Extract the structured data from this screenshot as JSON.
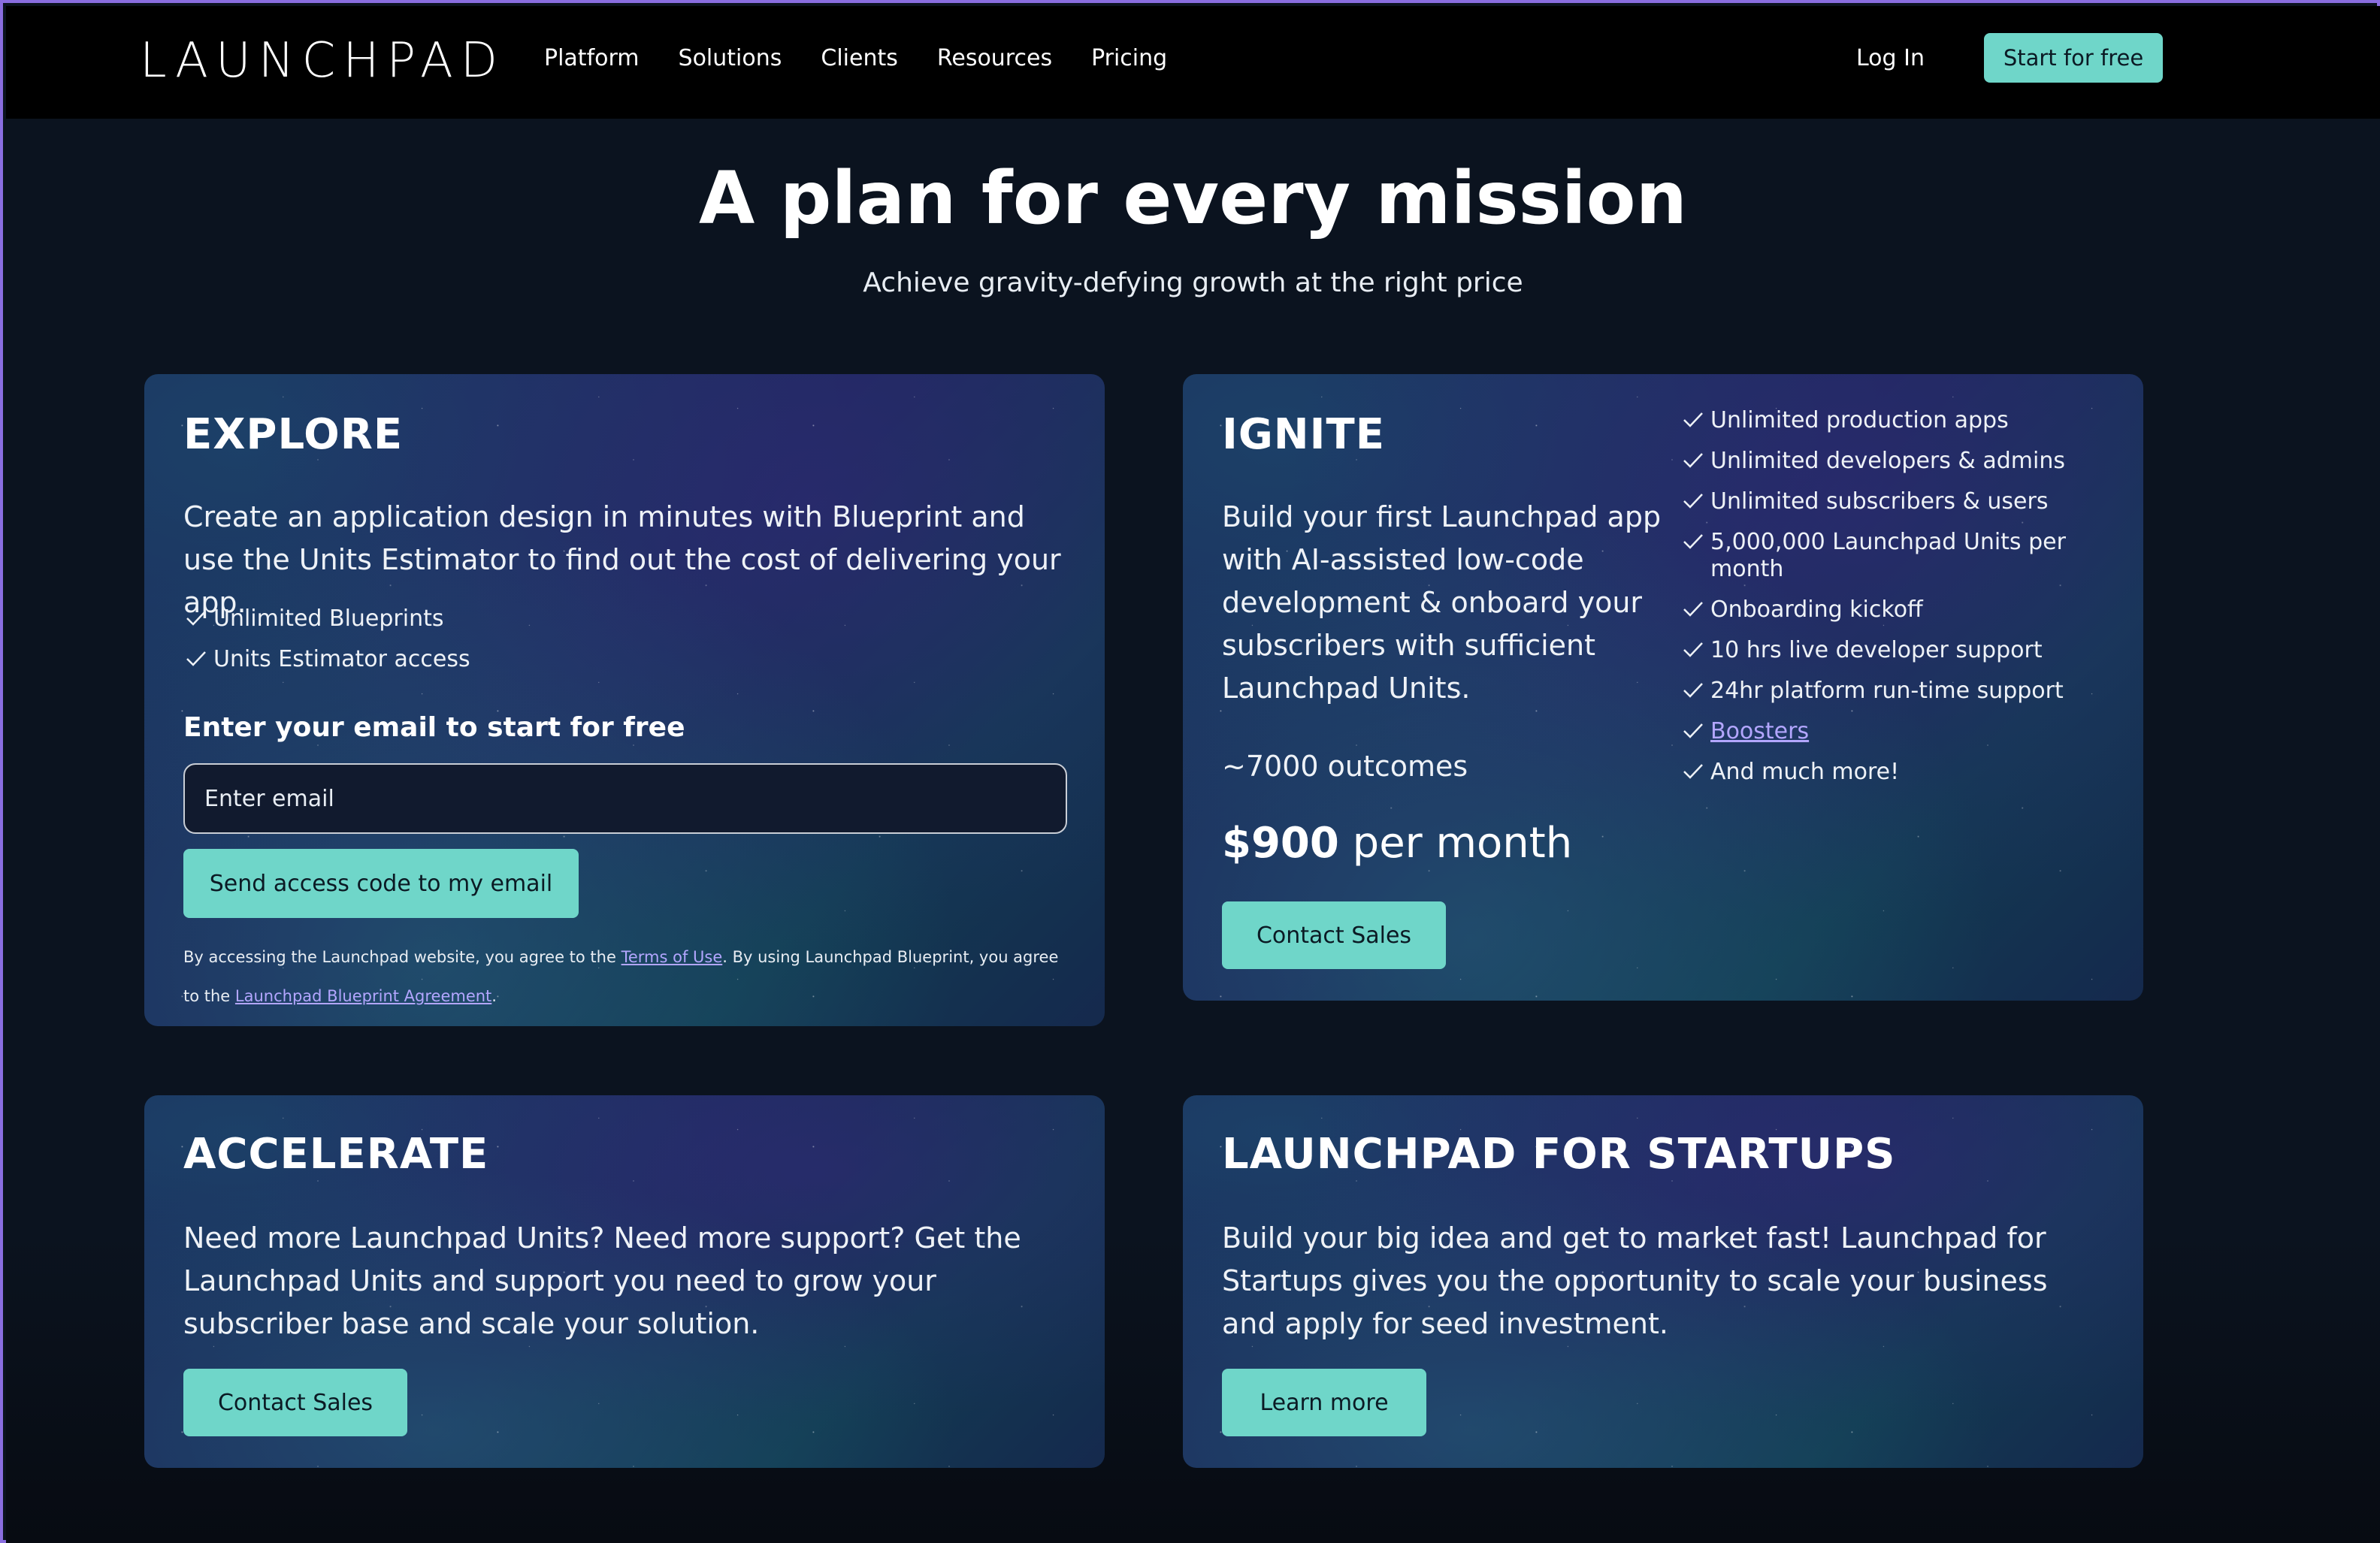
{
  "nav": {
    "logo": "LAUNCHPAD",
    "links": [
      "Platform",
      "Solutions",
      "Clients",
      "Resources",
      "Pricing"
    ],
    "login": "Log In",
    "cta": "Start for free"
  },
  "hero": {
    "title": "A plan for every mission",
    "subtitle": "Achieve gravity-defying growth at the right price"
  },
  "explore": {
    "title": "EXPLORE",
    "description": "Create an application design in minutes with Blueprint and use the Units Estimator to find out the cost of delivering your app.",
    "features": [
      "Unlimited Blueprints",
      "Units Estimator access"
    ],
    "email_label": "Enter your email to start for free",
    "email_placeholder": "Enter email",
    "button": "Send access code to my email",
    "legal_1": "By accessing the Launchpad website, you agree to the",
    "terms_link": "Terms of Use",
    "legal_2": ". By using Launchpad Blueprint, you agree to the",
    "agreement_link": "Launchpad Blueprint Agreement",
    "legal_3": "."
  },
  "ignite": {
    "title": "IGNITE",
    "description": "Build your first Launchpad app with AI-assisted low-code development & onboard your subscribers with sufficient Launchpad Units.",
    "outcomes": "~7000 outcomes",
    "price_amount": "$900",
    "price_period": "per month",
    "button": "Contact Sales",
    "features": [
      "Unlimited production apps",
      "Unlimited developers & admins",
      "Unlimited subscribers & users",
      "5,000,000 Launchpad Units per month",
      "Onboarding kickoff",
      "10 hrs live developer support",
      "24hr platform run-time support",
      "Boosters",
      "And much more!"
    ]
  },
  "accelerate": {
    "title": "ACCELERATE",
    "description": "Need more Launchpad Units? Need more support? Get the Launchpad Units and support you need to grow your subscriber base and scale your solution.",
    "button": "Contact Sales"
  },
  "startups": {
    "title": "LAUNCHPAD FOR STARTUPS",
    "description": "Build your big idea and get to market fast! Launchpad for Startups gives you the opportunity to scale your business and apply for seed investment.",
    "button": "Learn more"
  },
  "colors": {
    "accent": "#6fd6c9",
    "link": "#b3a6ff",
    "nav_bg": "#000000",
    "page_bg": "#0b131f"
  }
}
